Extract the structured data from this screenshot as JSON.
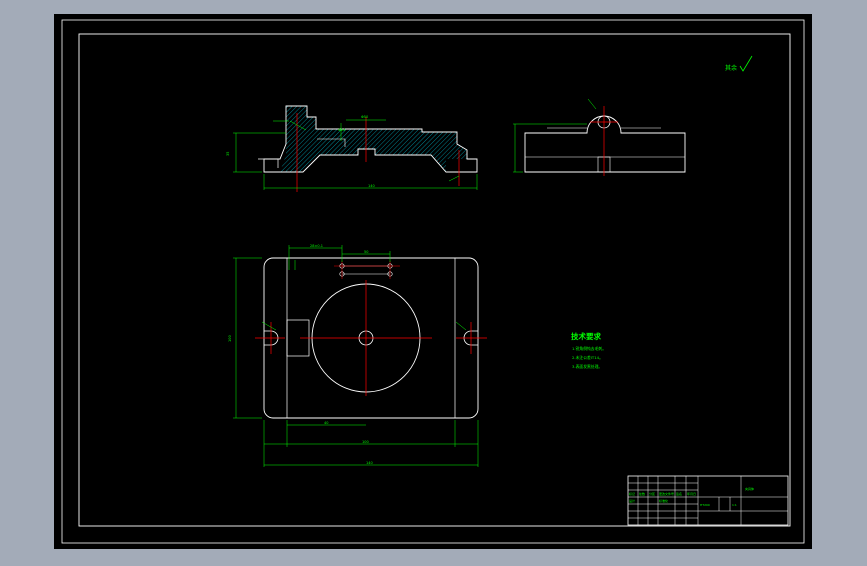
{
  "drawing": {
    "surface_mark": "其余",
    "tech_requirements": {
      "title": "技术要求",
      "lines": [
        "1.锐角倒钝去毛刺。",
        "2.未注公差IT14。",
        "3.表面发黑处理。"
      ]
    },
    "dimensions": {
      "front_top": "Φ50",
      "front_bore": "Φ14",
      "front_height": "35",
      "front_width": "140",
      "plan_top_offset": "28±0.1",
      "plan_top_span": "50",
      "plan_height": "100",
      "plan_inner_width": "100",
      "plan_inner_left": "40",
      "plan_total_width": "140"
    },
    "title_block": {
      "row1": [
        "标记",
        "处数",
        "分区",
        "更改文件号",
        "签名",
        "年月日"
      ],
      "row2": [
        "设计",
        "",
        "",
        "标准化",
        "",
        ""
      ],
      "material": "HT200",
      "part": "夹具体",
      "scale": "1:1"
    }
  },
  "colors": {
    "outline": "#ffffff",
    "dimension": "#00ff00",
    "centerline": "#ff0000",
    "hatch": "#00b4c8",
    "sheet": "#000000",
    "frame": "#ffffff",
    "titleblock_lines": "#ffffff"
  }
}
